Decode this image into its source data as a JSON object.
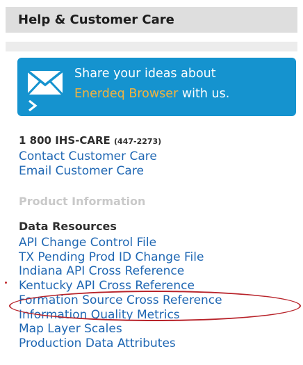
{
  "header": {
    "title": "Help & Customer Care"
  },
  "banner": {
    "line1": "Share your ideas about",
    "brand": "Enerdeq Browser",
    "line2_suffix": " with us.",
    "icon": "envelope-icon",
    "chevron": "chevron-right-icon"
  },
  "contact": {
    "phone": "1 800 IHS-CARE",
    "phone_alt": "(447-2273)",
    "links": [
      "Contact Customer Care",
      "Email Customer Care"
    ]
  },
  "product_info": {
    "heading": "Product Information"
  },
  "data_resources": {
    "heading": "Data Resources",
    "links": [
      "API Change Control File",
      "TX Pending Prod ID Change File",
      "Indiana API Cross Reference",
      "Kentucky API Cross Reference",
      "Formation Source Cross Reference",
      "Information Quality Metrics",
      "Map Layer Scales",
      "Production Data Attributes"
    ],
    "highlighted_index": 4
  },
  "colors": {
    "link": "#1f67b3",
    "banner_bg": "#1593cf",
    "brand_text": "#f4b33d",
    "highlight_ellipse": "#b8232a"
  }
}
